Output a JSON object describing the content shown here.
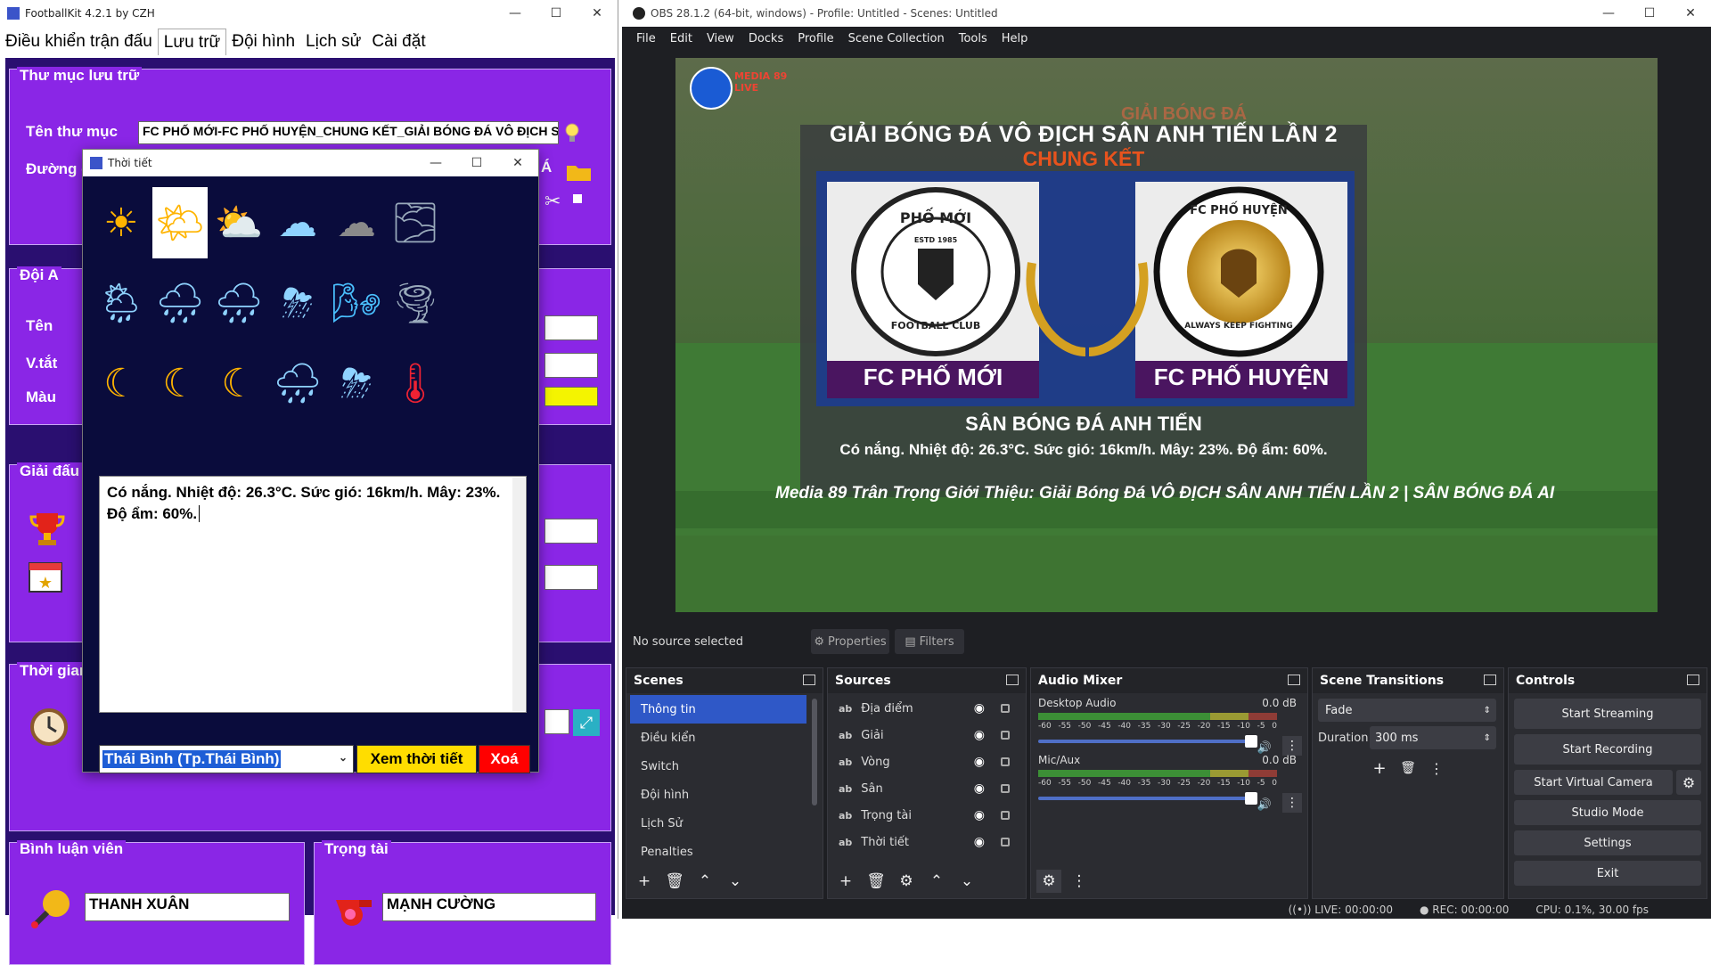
{
  "footballkit": {
    "window_title": "FootballKit 4.2.1 by CZH",
    "menu": [
      "Điều khiển trận đấu",
      "Lưu trữ",
      "Đội hình",
      "Lịch sử",
      "Cài đặt"
    ],
    "storage": {
      "legend": "Thư mục lưu trữ",
      "folder_label": "Tên thư mục",
      "folder_value": "FC PHỐ MỚI-FC PHỐ HUYỆN_CHUNG KẾT_GIẢI BÓNG ĐÁ VÔ ĐỊCH SÂN",
      "path_label": "Đường d",
      "path_value": "Á"
    },
    "team_a": {
      "legend": "Đội A",
      "name_label": "Tên",
      "abbr_label": "V.tắt",
      "color_label": "Màu",
      "color_value": "#f4f400"
    },
    "tournament": {
      "legend": "Giải đấu"
    },
    "time": {
      "legend": "Thời gian"
    },
    "commentator": {
      "legend": "Bình luận viên",
      "value": "THANH XUÂN"
    },
    "referee": {
      "legend": "Trọng tài",
      "value": "MẠNH CƯỜNG"
    }
  },
  "weather_dialog": {
    "title": "Thời tiết",
    "icons": [
      "sun-icon",
      "sun-cloud-icon",
      "partly-cloudy-icon",
      "cloud-icon",
      "dark-cloud-icon",
      "fog-icon",
      "sun-rain-icon",
      "rain-cloud-icon",
      "heavy-rain-icon",
      "thunderstorm-icon",
      "wind-icon",
      "tornado-icon",
      "moon-icon",
      "moon-wind-icon",
      "moon-cloud-icon",
      "night-rain-icon",
      "night-storm-icon",
      "thermometer-icon"
    ],
    "selected_index": 1,
    "text": "Có nắng. Nhiệt độ: 26.3°C. Sức gió: 16km/h. Mây: 23%. Độ ẩm: 60%.",
    "location": "Thái Bình (Tp.Thái Bình)",
    "view_button": "Xem thời tiết",
    "delete_button": "Xoá"
  },
  "obs": {
    "window_title": "OBS 28.1.2 (64-bit, windows) - Profile: Untitled - Scenes: Untitled",
    "menu": [
      "File",
      "Edit",
      "View",
      "Docks",
      "Profile",
      "Scene Collection",
      "Tools",
      "Help"
    ],
    "preview": {
      "logo_text": "MEDIA 89 LIVE",
      "tournament_title": "GIẢI BÓNG ĐÁ VÔ ĐỊCH SÂN ANH TIẾN LẦN 2",
      "round": "CHUNG KẾT",
      "team_left_logo_text": "PHỐ MỚI",
      "team_left_logo_sub": "FOOTBALL CLUB",
      "team_left_logo_estd": "ESTD 1985",
      "team_left_name": "FC PHỐ MỚI",
      "team_right_logo_text": "FC PHỐ HUYỆN",
      "team_right_logo_sub": "ALWAYS KEEP FIGHTING",
      "team_right_name": "FC PHỐ HUYỆN",
      "venue": "SÂN BÓNG ĐÁ ANH TIẾN",
      "weather": "Có nắng. Nhiệt độ: 26.3°C. Sức gió: 16km/h. Mây: 23%. Độ ẩm: 60%.",
      "ticker": "Media 89 Trân Trọng Giới Thiệu: Giải Bóng Đá VÔ ĐỊCH SÂN ANH TIẾN LẦN 2 | SÂN BÓNG ĐÁ AI",
      "banner_bg": "GIẢI BÓNG ĐÁ"
    },
    "source_bar": {
      "status": "No source selected",
      "properties": "Properties",
      "filters": "Filters"
    },
    "scenes": {
      "title": "Scenes",
      "items": [
        "Thông tin",
        "Điều kiển",
        "Switch",
        "Đội hình",
        "Lịch Sử",
        "Penalties"
      ],
      "selected": 0
    },
    "sources": {
      "title": "Sources",
      "items": [
        "Địa điểm",
        "Giải",
        "Vòng",
        "Sân",
        "Trọng tài",
        "Thời tiết"
      ]
    },
    "audio": {
      "title": "Audio Mixer",
      "channels": [
        {
          "name": "Desktop Audio",
          "level": "0.0 dB",
          "volume": 1.0
        },
        {
          "name": "Mic/Aux",
          "level": "0.0 dB",
          "volume": 1.0
        }
      ],
      "scale": [
        "-60",
        "-55",
        "-50",
        "-45",
        "-40",
        "-35",
        "-30",
        "-25",
        "-20",
        "-15",
        "-10",
        "-5",
        "0"
      ]
    },
    "transitions": {
      "title": "Scene Transitions",
      "type": "Fade",
      "duration_label": "Duration",
      "duration": "300 ms"
    },
    "controls": {
      "title": "Controls",
      "buttons": [
        "Start Streaming",
        "Start Recording",
        "Start Virtual Camera",
        "Studio Mode",
        "Settings",
        "Exit"
      ]
    },
    "status": {
      "live": "LIVE: 00:00:00",
      "rec": "REC: 00:00:00",
      "cpu": "CPU: 0.1%, 30.00 fps"
    }
  }
}
